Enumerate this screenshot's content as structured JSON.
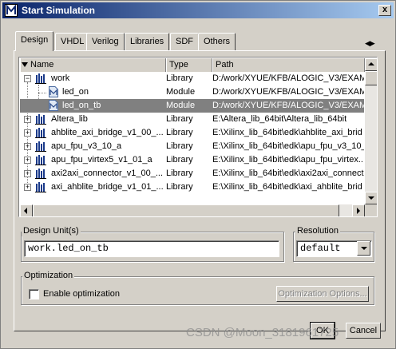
{
  "window": {
    "title": "Start Simulation",
    "close_label": "x"
  },
  "tabs": [
    {
      "label": "Design",
      "active": true
    },
    {
      "label": "VHDL"
    },
    {
      "label": "Verilog"
    },
    {
      "label": "Libraries"
    },
    {
      "label": "SDF"
    },
    {
      "label": "Others"
    }
  ],
  "list": {
    "columns": [
      "Name",
      "Type",
      "Path"
    ],
    "rows": [
      {
        "name": "work",
        "type": "Library",
        "path": "D:/work/XYUE/KFB/ALOGIC_V3/EXAM...",
        "kind": "library",
        "expander": "−",
        "indent": 0
      },
      {
        "name": "led_on",
        "type": "Module",
        "path": "D:/work/XYUE/KFB/ALOGIC_V3/EXAM...",
        "kind": "module",
        "indent": 1
      },
      {
        "name": "led_on_tb",
        "type": "Module",
        "path": "D:/work/XYUE/KFB/ALOGIC_V3/EXAM...",
        "kind": "module",
        "indent": 1,
        "selected": true
      },
      {
        "name": "Altera_lib",
        "type": "Library",
        "path": "E:\\Altera_lib_64bit\\Altera_lib_64bit",
        "kind": "library",
        "expander": "+",
        "indent": 0
      },
      {
        "name": "ahblite_axi_bridge_v1_00_...",
        "type": "Library",
        "path": "E:\\Xilinx_lib_64bit\\edk\\ahblite_axi_brid",
        "kind": "library",
        "expander": "+",
        "indent": 0
      },
      {
        "name": "apu_fpu_v3_10_a",
        "type": "Library",
        "path": "E:\\Xilinx_lib_64bit\\edk\\apu_fpu_v3_10_a",
        "kind": "library",
        "expander": "+",
        "indent": 0
      },
      {
        "name": "apu_fpu_virtex5_v1_01_a",
        "type": "Library",
        "path": "E:\\Xilinx_lib_64bit\\edk\\apu_fpu_virtex...",
        "kind": "library",
        "expander": "+",
        "indent": 0
      },
      {
        "name": "axi2axi_connector_v1_00_...",
        "type": "Library",
        "path": "E:\\Xilinx_lib_64bit\\edk\\axi2axi_connect...",
        "kind": "library",
        "expander": "+",
        "indent": 0
      },
      {
        "name": "axi_ahblite_bridge_v1_01_...",
        "type": "Library",
        "path": "E:\\Xilinx_lib_64bit\\edk\\axi_ahblite_brid",
        "kind": "library",
        "expander": "+",
        "indent": 0
      }
    ]
  },
  "design_unit": {
    "label": "Design Unit(s)",
    "value": "work.led_on_tb"
  },
  "resolution": {
    "label": "Resolution",
    "value": "default"
  },
  "optimization": {
    "label": "Optimization",
    "checkbox_label": "Enable optimization",
    "options_button": "Optimization Options..."
  },
  "buttons": {
    "ok": "OK",
    "cancel": "Cancel"
  },
  "watermark": "CSDN @Moon_3181961725",
  "colors": {
    "title_start": "#0a246a",
    "title_end": "#a6caf0",
    "selected_row": "#808080",
    "face": "#d4d0c8"
  }
}
